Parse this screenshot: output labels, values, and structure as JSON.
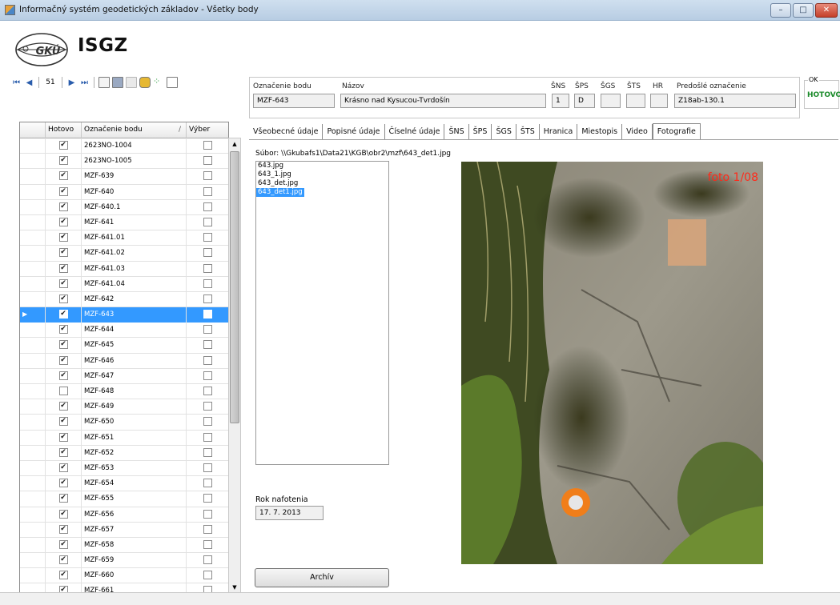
{
  "window": {
    "title": "Informačný systém geodetických základov - Všetky body",
    "minimize": "–",
    "maximize": "□",
    "close": "✕"
  },
  "app": {
    "name": "ISGZ",
    "logo_text": "GKÚ"
  },
  "navigator": {
    "position": "51"
  },
  "header": {
    "oznacenie_label": "Označenie bodu",
    "oznacenie_value": "MZF-643",
    "nazov_label": "Názov",
    "nazov_value": "Krásno nad Kysucou-Tvrdošín",
    "sns_label": "ŠNS",
    "sns_value": "1",
    "sps_label": "ŠPS",
    "sps_value": "D",
    "sgs_label": "ŠGS",
    "sgs_value": "",
    "sts_label": "ŠTS",
    "sts_value": "",
    "hr_label": "HR",
    "hr_value": "",
    "predosle_label": "Predošlé označenie",
    "predosle_value": "Z18ab-130.1",
    "ok_label": "OK",
    "ok_value": "HOTOVO"
  },
  "grid": {
    "columns": [
      "Hotovo",
      "Označenie bodu",
      "Výber"
    ],
    "sort_glyph": "/",
    "selected_index": 11,
    "rows": [
      {
        "hotovo": true,
        "oznacenie": "2623NO-1004",
        "vyber": false
      },
      {
        "hotovo": true,
        "oznacenie": "2623NO-1005",
        "vyber": false
      },
      {
        "hotovo": true,
        "oznacenie": "MZF-639",
        "vyber": false
      },
      {
        "hotovo": true,
        "oznacenie": "MZF-640",
        "vyber": false
      },
      {
        "hotovo": true,
        "oznacenie": "MZF-640.1",
        "vyber": false
      },
      {
        "hotovo": true,
        "oznacenie": "MZF-641",
        "vyber": false
      },
      {
        "hotovo": true,
        "oznacenie": "MZF-641.01",
        "vyber": false
      },
      {
        "hotovo": true,
        "oznacenie": "MZF-641.02",
        "vyber": false
      },
      {
        "hotovo": true,
        "oznacenie": "MZF-641.03",
        "vyber": false
      },
      {
        "hotovo": true,
        "oznacenie": "MZF-641.04",
        "vyber": false
      },
      {
        "hotovo": true,
        "oznacenie": "MZF-642",
        "vyber": false
      },
      {
        "hotovo": true,
        "oznacenie": "MZF-643",
        "vyber": false
      },
      {
        "hotovo": true,
        "oznacenie": "MZF-644",
        "vyber": false
      },
      {
        "hotovo": true,
        "oznacenie": "MZF-645",
        "vyber": false
      },
      {
        "hotovo": true,
        "oznacenie": "MZF-646",
        "vyber": false
      },
      {
        "hotovo": true,
        "oznacenie": "MZF-647",
        "vyber": false
      },
      {
        "hotovo": false,
        "oznacenie": "MZF-648",
        "vyber": false
      },
      {
        "hotovo": true,
        "oznacenie": "MZF-649",
        "vyber": false
      },
      {
        "hotovo": true,
        "oznacenie": "MZF-650",
        "vyber": false
      },
      {
        "hotovo": true,
        "oznacenie": "MZF-651",
        "vyber": false
      },
      {
        "hotovo": true,
        "oznacenie": "MZF-652",
        "vyber": false
      },
      {
        "hotovo": true,
        "oznacenie": "MZF-653",
        "vyber": false
      },
      {
        "hotovo": true,
        "oznacenie": "MZF-654",
        "vyber": false
      },
      {
        "hotovo": true,
        "oznacenie": "MZF-655",
        "vyber": false
      },
      {
        "hotovo": true,
        "oznacenie": "MZF-656",
        "vyber": false
      },
      {
        "hotovo": true,
        "oznacenie": "MZF-657",
        "vyber": false
      },
      {
        "hotovo": true,
        "oznacenie": "MZF-658",
        "vyber": false
      },
      {
        "hotovo": true,
        "oznacenie": "MZF-659",
        "vyber": false
      },
      {
        "hotovo": true,
        "oznacenie": "MZF-660",
        "vyber": false
      },
      {
        "hotovo": true,
        "oznacenie": "MZF-661",
        "vyber": false
      }
    ]
  },
  "tabs": [
    "Všeobecné údaje",
    "Popisné údaje",
    "Číselné údaje",
    "ŠNS",
    "ŠPS",
    "ŠGS",
    "ŠTS",
    "Hranica",
    "Miestopis",
    "Video",
    "Fotografie"
  ],
  "active_tab": "Fotografie",
  "photos": {
    "path": "Súbor: \\\\Gkubafs1\\Data21\\KGB\\obr2\\mzf\\643_det1.jpg",
    "files": [
      "643.jpg",
      "643_1.jpg",
      "643_det.jpg",
      "643_det1.jpg"
    ],
    "selected_file": "643_det1.jpg",
    "year_label": "Rok nafotenia",
    "year_value": "17. 7. 2013",
    "archive_button": "Archív",
    "caption": "foto 1/08"
  }
}
